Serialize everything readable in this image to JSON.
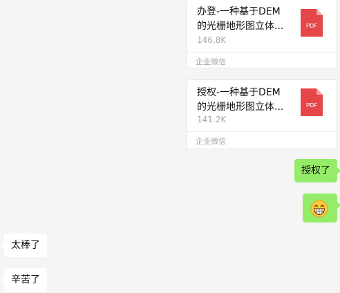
{
  "messages": {
    "file1": {
      "title": "办登-一种基于DEM的光栅地形图立体...",
      "size": "146.8K",
      "source": "企业微信",
      "file_type": "PDF",
      "icon": "pdf-file-icon"
    },
    "file2": {
      "title": "授权-一种基于DEM的光栅地形图立体...",
      "size": "141.2K",
      "source": "企业微信",
      "file_type": "PDF",
      "icon": "pdf-file-icon"
    },
    "authorized": "授权了",
    "emoji": "grinning-face-icon",
    "great": "太棒了",
    "thanks": "辛苦了"
  },
  "colors": {
    "chat_background": "#f5f5f5",
    "outgoing_bubble": "#95ec69",
    "incoming_bubble": "#ffffff",
    "pdf_icon": "#e6454a"
  }
}
